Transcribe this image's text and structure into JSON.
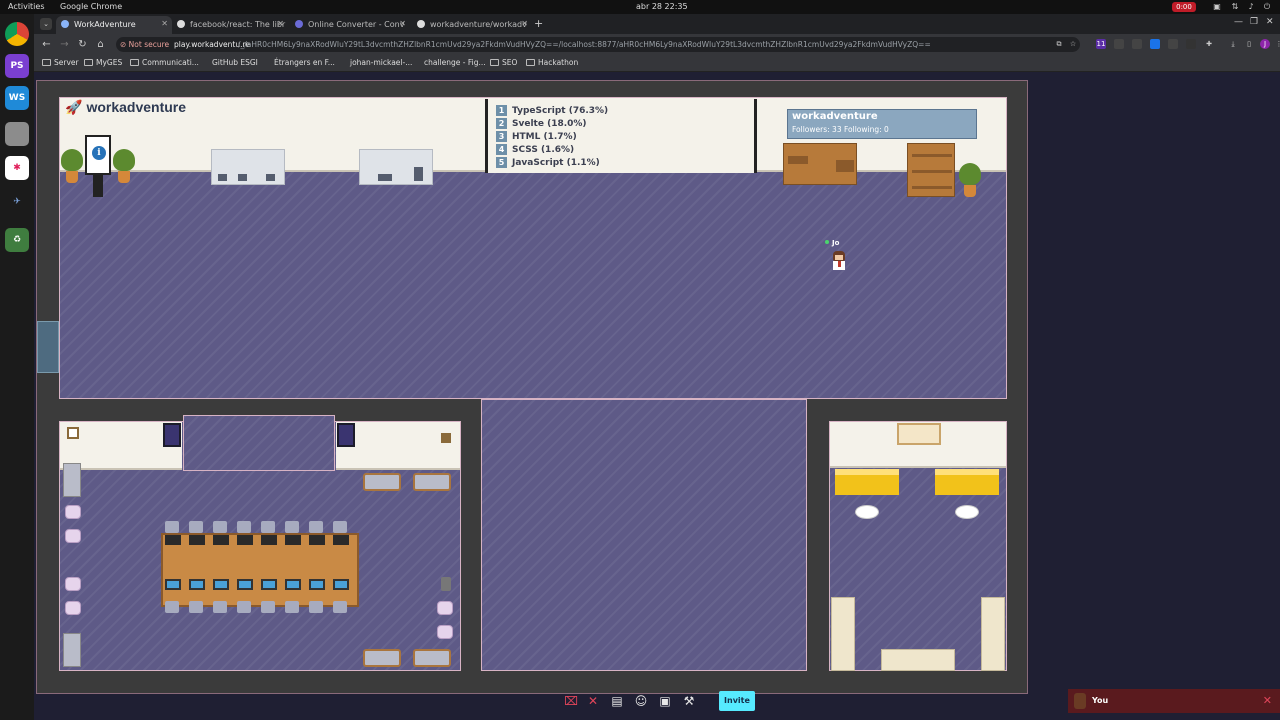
{
  "gnome": {
    "activities": "Activities",
    "app_name": "Google Chrome",
    "clock": "abr 28  22:35",
    "rec_badge": "0:00"
  },
  "chrome": {
    "tabs": [
      {
        "label": "WorkAdventure"
      },
      {
        "label": "facebook/react: The libr"
      },
      {
        "label": "Online Converter - Conv"
      },
      {
        "label": "workadventure/workadv"
      }
    ],
    "new_tab": "+",
    "address": {
      "not_secure": "Not secure",
      "host": "play.workadventu.re",
      "rest": "/_/aHR0cHM6Ly9naXRodWIuY29tL3dvcmthZHZlbnR1cmUvd29ya2FkdmVudHVyZQ==/localhost:8877/aHR0cHM6Ly9naXRodWIuY29tL3dvcmthZHZlbnR1cmUvd29ya2FkdmVudHVyZQ=="
    },
    "ext_badge": "11",
    "profile_initial": "J",
    "bookmarks": [
      {
        "label": "Server",
        "folder": true
      },
      {
        "label": "MyGES",
        "folder": true
      },
      {
        "label": "Communicati...",
        "folder": true
      },
      {
        "label": "GitHub ESGI",
        "folder": false
      },
      {
        "label": "Étrangers en F...",
        "folder": false
      },
      {
        "label": "johan-mickael-...",
        "folder": false
      },
      {
        "label": "challenge - Fig...",
        "folder": false
      },
      {
        "label": "SEO",
        "folder": true
      },
      {
        "label": "Hackathon",
        "folder": true
      }
    ]
  },
  "dock": {
    "items": [
      {
        "name": "chrome",
        "text": ""
      },
      {
        "name": "phpstorm",
        "text": "PS"
      },
      {
        "name": "webstorm",
        "text": "WS"
      },
      {
        "name": "files",
        "text": ""
      },
      {
        "name": "slack",
        "text": ""
      },
      {
        "name": "satellite",
        "text": ""
      },
      {
        "name": "trash",
        "text": "♻"
      }
    ]
  },
  "game": {
    "logo": "workadventure",
    "info_icon": "i",
    "languages": [
      {
        "rank": "1",
        "label": "TypeScript (76.3%)"
      },
      {
        "rank": "2",
        "label": "Svelte (18.0%)"
      },
      {
        "rank": "3",
        "label": "HTML (1.7%)"
      },
      {
        "rank": "4",
        "label": "SCSS (1.6%)"
      },
      {
        "rank": "5",
        "label": "JavaScript (1.1%)"
      }
    ],
    "github_card": {
      "name": "workadventure",
      "stats": "Followers: 33  Following: 0"
    },
    "player": {
      "name": "Jo"
    }
  },
  "actionbar": {
    "invite_label": "Invite",
    "you_label": "You"
  },
  "colors": {
    "floor": "#5e5a87",
    "invite": "#56eaff",
    "danger": "#e0455a"
  }
}
